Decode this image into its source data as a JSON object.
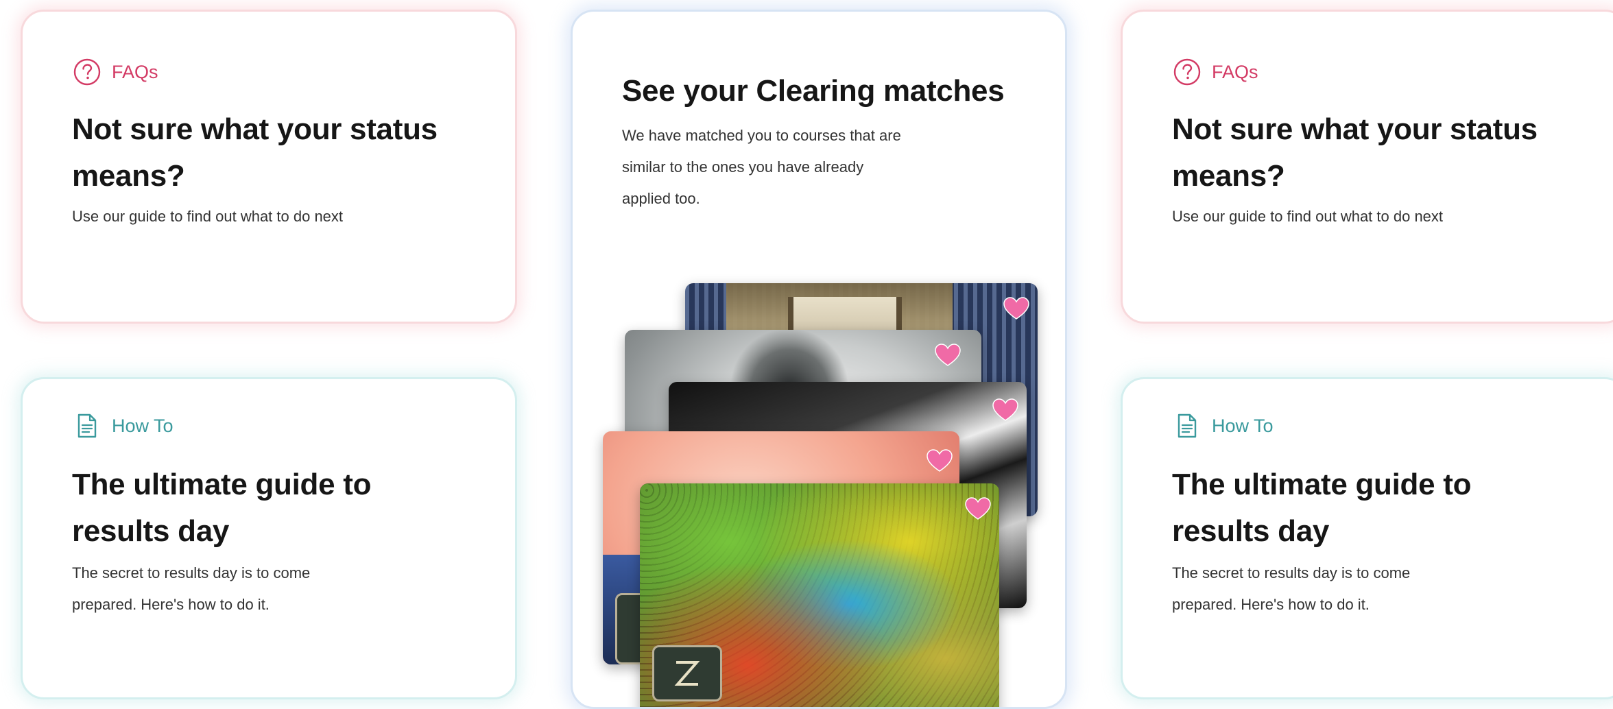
{
  "cards": {
    "faq_left": {
      "tag": "FAQs",
      "title_line1": "Not sure what your status",
      "title_line2": "means?",
      "description": "Use our guide to find out what to do next"
    },
    "faq_right": {
      "tag": "FAQs",
      "title_line1": "Not sure what your status",
      "title_line2": "means?",
      "description": "Use our guide to find out what to do next"
    },
    "howto_left": {
      "tag": "How To",
      "title_line1": "The ultimate guide to",
      "title_line2": "results day",
      "description_line1": "The secret to results day is to come",
      "description_line2": "prepared. Here's how to do it."
    },
    "howto_right": {
      "tag": "How To",
      "title_line1": "The ultimate guide to",
      "title_line2": "results day",
      "description_line1": "The secret to results day is to come",
      "description_line2": "prepared. Here's how to do it."
    },
    "clearing": {
      "title": "See your Clearing matches",
      "description_line1": "We have matched you to courses that are",
      "description_line2": "similar to the ones you have already",
      "description_line3": "applied too."
    }
  },
  "icons": {
    "faq": "question-circle-icon",
    "howto": "document-icon",
    "favourite": "heart-icon"
  },
  "colors": {
    "faq_accent": "#d33a64",
    "howto_accent": "#3a9a9d",
    "heart": "#f06aa6",
    "title_text": "#161616"
  }
}
